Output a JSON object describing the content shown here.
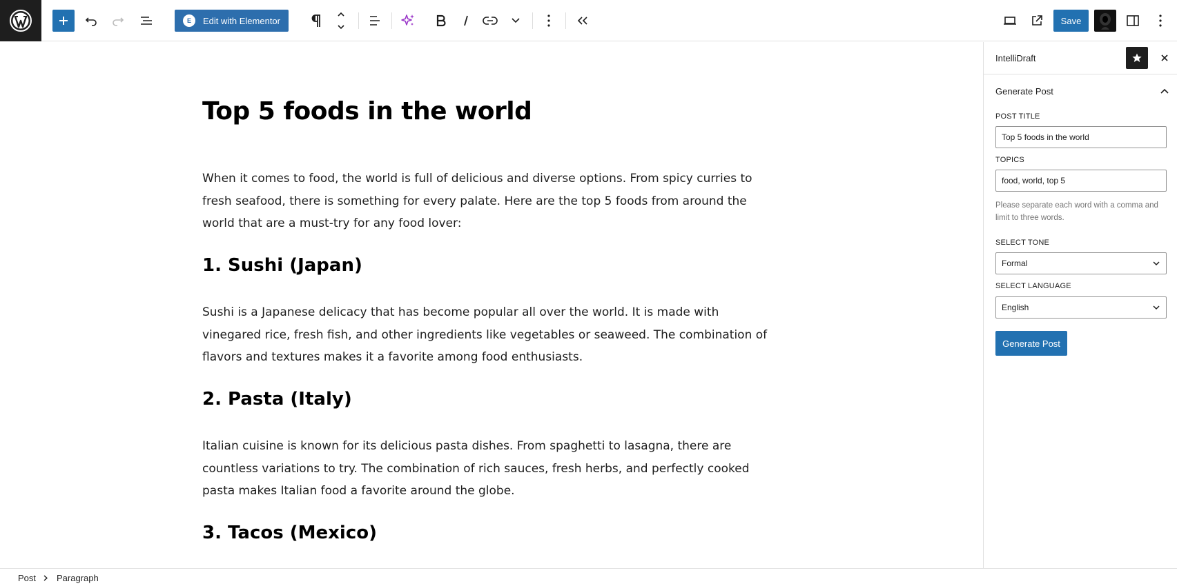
{
  "toolbar": {
    "elementor_label": "Edit with Elementor",
    "elementor_badge": "E",
    "save_label": "Save"
  },
  "post": {
    "title": "Top 5 foods in the world",
    "intro": "When it comes to food, the world is full of delicious and diverse options. From spicy curries to fresh seafood, there is something for every palate. Here are the top 5 foods from around the world that are a must-try for any food lover:",
    "sections": [
      {
        "heading": "1. Sushi (Japan)",
        "body": "Sushi is a Japanese delicacy that has become popular all over the world. It is made with vinegared rice, fresh fish, and other ingredients like vegetables or seaweed. The combination of flavors and textures makes it a favorite among food enthusiasts."
      },
      {
        "heading": "2. Pasta (Italy)",
        "body": "Italian cuisine is known for its delicious pasta dishes. From spaghetti to lasagna, there are countless variations to try. The combination of rich sauces, fresh herbs, and perfectly cooked pasta makes Italian food a favorite around the globe."
      },
      {
        "heading": "3. Tacos (Mexico)"
      }
    ]
  },
  "sidebar": {
    "title": "IntelliDraft",
    "panel_title": "Generate Post",
    "post_title_label": "POST TITLE",
    "post_title_value": "Top 5 foods in the world",
    "topics_label": "TOPICS",
    "topics_value": "food, world, top 5",
    "topics_help": "Please separate each word with a comma and limit to three words.",
    "tone_label": "SELECT TONE",
    "tone_value": "Formal",
    "language_label": "SELECT LANGUAGE",
    "language_value": "English",
    "generate_label": "Generate Post"
  },
  "breadcrumb": {
    "items": [
      "Post",
      "Paragraph"
    ]
  },
  "colors": {
    "accent": "#2271b1",
    "elementor": "#2d6ead",
    "ai_sparkle": "#9b38c9",
    "dark": "#1e1e1e"
  },
  "icons": [
    "wordpress-logo-icon",
    "plus-icon",
    "undo-icon",
    "redo-icon",
    "list-view-icon",
    "paragraph-icon",
    "move-up-down-icon",
    "align-icon",
    "ai-sparkle-icon",
    "bold-icon",
    "italic-icon",
    "link-icon",
    "chevron-down-icon",
    "more-options-icon",
    "collapse-icon",
    "view-desktop-icon",
    "external-preview-icon",
    "sidebar-toggle-icon",
    "star-icon",
    "close-icon",
    "chevron-up-icon"
  ]
}
